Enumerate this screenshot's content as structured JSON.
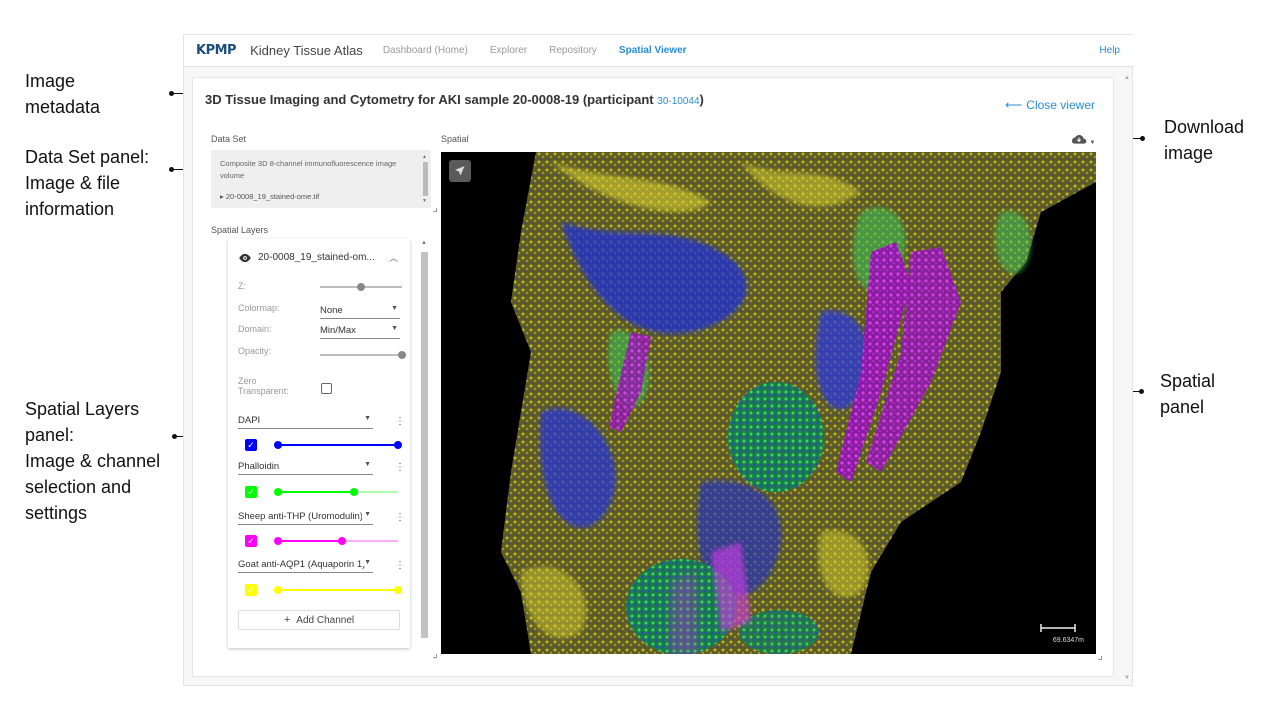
{
  "annotations": {
    "image_metadata": [
      "Image",
      "metadata"
    ],
    "dataset_panel": [
      "Data Set panel:",
      "Image & file",
      "information"
    ],
    "layers_panel": [
      "Spatial Layers",
      "panel:",
      "Image & channel",
      "selection and",
      "settings"
    ],
    "download": [
      "Download",
      "image"
    ],
    "spatial_panel": [
      "Spatial",
      "panel"
    ]
  },
  "nav": {
    "logo": "KPMP",
    "app_title": "Kidney Tissue Atlas",
    "links": [
      "Dashboard (Home)",
      "Explorer",
      "Repository",
      "Spatial Viewer"
    ],
    "active": "Spatial Viewer",
    "help": "Help"
  },
  "header": {
    "title": "3D Tissue Imaging and Cytometry for AKI sample 20-0008-19 (participant",
    "participant_id": "30-10044",
    "title_close": ")",
    "close_viewer": "Close viewer"
  },
  "dataset": {
    "label": "Data Set",
    "description": "Composite 3D 8-channel immunofluorescence image volume",
    "file": "20-0008_19_stained-ome.tif"
  },
  "layers": {
    "label": "Spatial Layers",
    "layer_name": "20-0008_19_stained-om...",
    "z_label": "Z:",
    "colormap_label": "Colormap:",
    "colormap_value": "None",
    "domain_label": "Domain:",
    "domain_value": "Min/Max",
    "opacity_label": "Opacity:",
    "zero_label": "Zero\nTransparent:",
    "z_value": 0.5,
    "opacity_value": 1.0,
    "channels": [
      {
        "name": "DAPI",
        "color": "#0000ff",
        "low": 0.0,
        "high": 1.0
      },
      {
        "name": "Phalloidin",
        "color": "#00ff00",
        "low": 0.0,
        "high": 0.63
      },
      {
        "name": "Sheep anti-THP (Uromodulin)",
        "color": "#ff00ff",
        "low": 0.0,
        "high": 0.53
      },
      {
        "name": "Goat anti-AQP1 (Aquaporin 1)",
        "color": "#ffff00",
        "low": 0.0,
        "high": 1.0
      }
    ],
    "add_channel": "Add Channel"
  },
  "spatial": {
    "label": "Spatial",
    "scale_label": "69.6347m",
    "download_icon": "cloud-download-icon"
  }
}
